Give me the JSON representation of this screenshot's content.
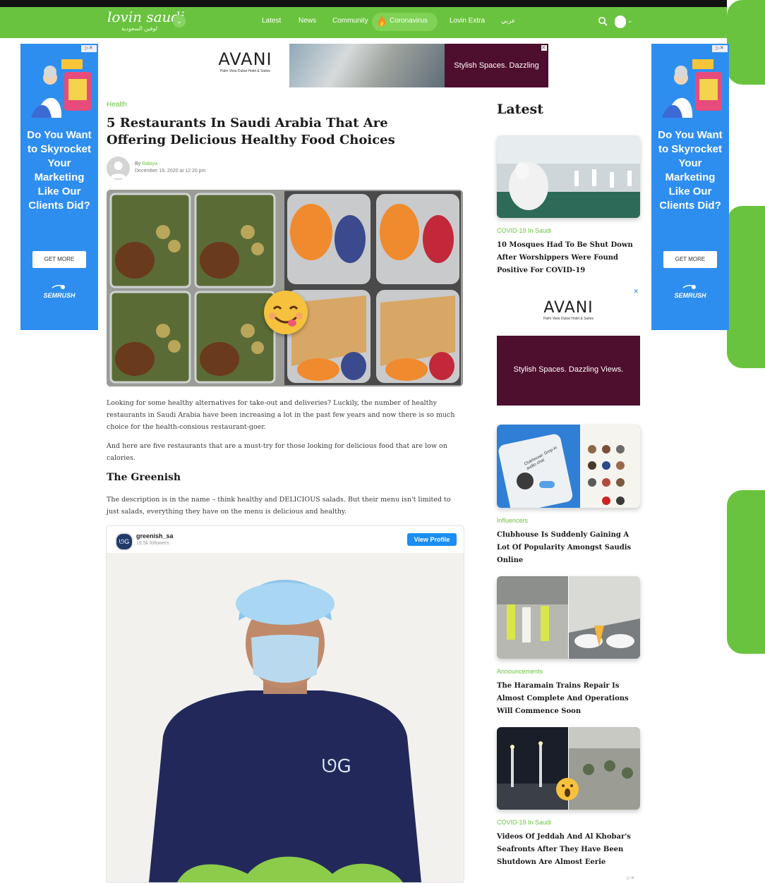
{
  "nav": {
    "logo": "lovin saudi",
    "logo_sub": "لوفين السعودية",
    "items": [
      "Latest",
      "News",
      "Community",
      "Coronavirus",
      "Lovin Extra",
      "عربي"
    ]
  },
  "ads": {
    "side_copy": "Do You Want to Skyrocket Your Marketing Like Our Clients Did?",
    "side_cta": "GET MORE",
    "side_brand": "SEMRUSH",
    "adchoice": "▷✕",
    "avani_brand": "AVANI",
    "avani_sub": "Palm View Dubai Hotel & Suites",
    "avani_tagline": "Stylish Spaces. Dazzling Views.",
    "close": "✕"
  },
  "article": {
    "category": "Health",
    "title": "5 Restaurants In Saudi Arabia That Are Offering Delicious Healthy Food Choices",
    "by_prefix": "By",
    "author": "Rabiya",
    "date": "December 19, 2020 at 12:20 pm",
    "para1": "Looking for some healthy alternatives for take-out and deliveries? Luckily, the number of healthy restaurants in Saudi Arabia have been increasing a lot in the past few years and now there is so much choice for the health-consious restaurant-goer.",
    "para2": "And here are five restaurants that are a must-try for those looking for delicious food that are low on calories.",
    "heading": "The Greenish",
    "para3": "The description is in the name – think healthy and DELICIOUS salads. But their menu isn't limited to just salads, everything they have on the menu is delicious and healthy."
  },
  "instagram": {
    "username": "greenish_sa",
    "followers": "19.5k followers",
    "button": "View Profile",
    "logo_text": "ᘎG",
    "shirt_logo": "ᘎG"
  },
  "sidebar": {
    "heading": "Latest",
    "cards": [
      {
        "category": "COVID-19 In Saudi",
        "title": "10 Mosques Had To Be Shut Down After Worshippers Were Found Positive For COVID-19"
      },
      {
        "category": "Influencers",
        "title": "Clubhouse Is Suddenly Gaining A Lot Of Popularity Amongst Saudis Online"
      },
      {
        "category": "Announcements",
        "title": "The Haramain Trains Repair Is Almost Complete And Operations Will Commence Soon"
      },
      {
        "category": "COVID-19 In Saudi",
        "title": "Videos Of Jeddah And Al Khobar's Seafronts After They Have Been Shutdown Are Almost Eerie"
      }
    ],
    "clubhouse_text": "Clubhouse: Drop-in audio chat"
  },
  "colors": {
    "brand_green": "#6ac33f",
    "ad_blue": "#2e8ef0",
    "avani_plum": "#4e0e2d",
    "insta_blue": "#1a8ef2"
  }
}
